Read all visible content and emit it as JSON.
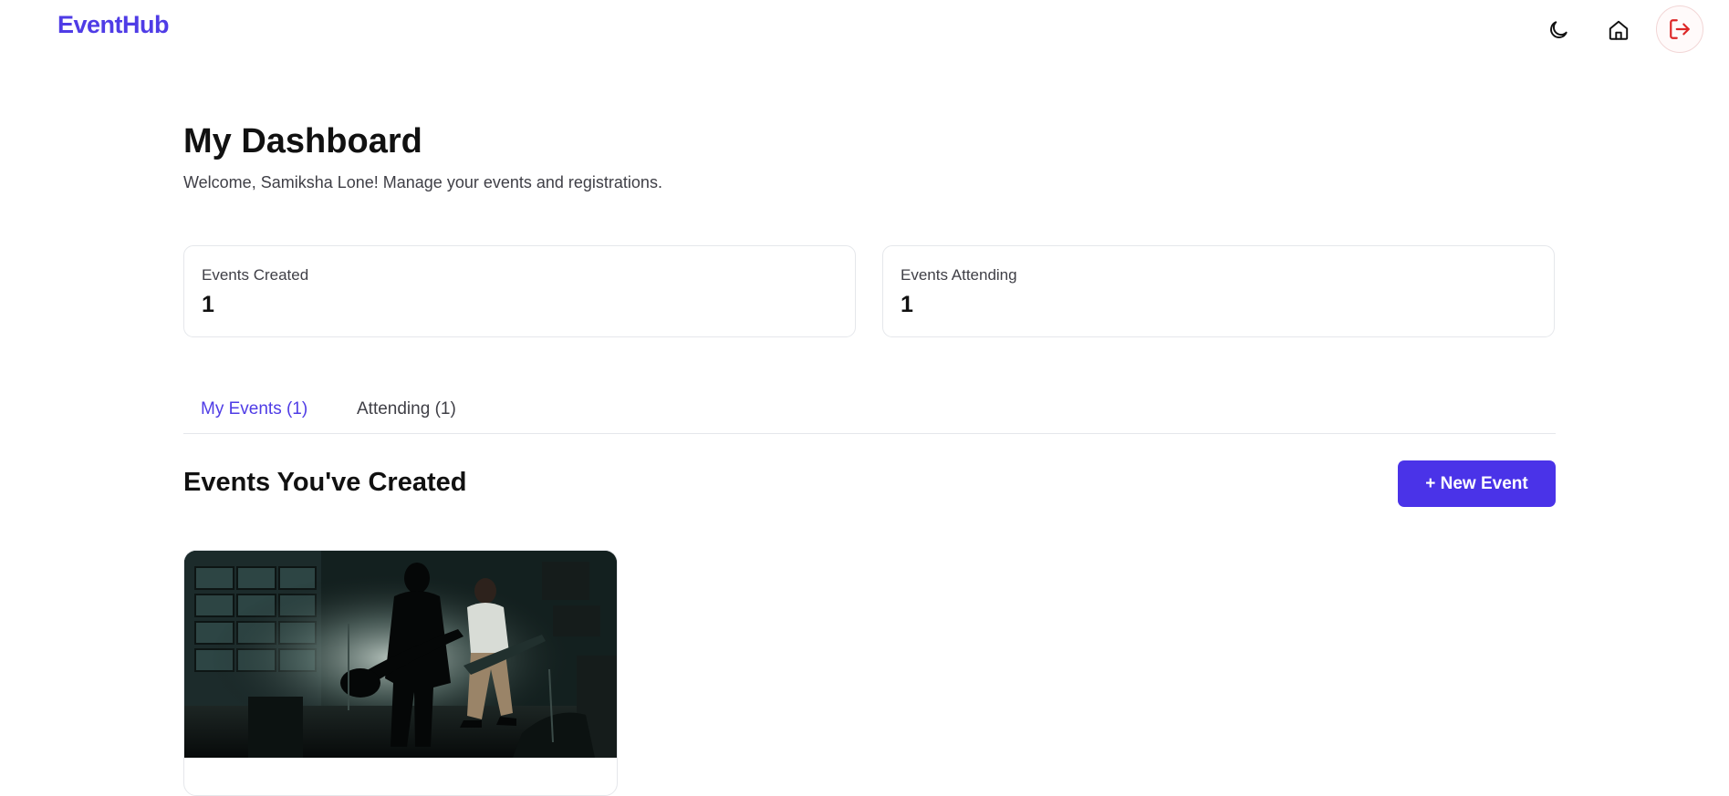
{
  "navbar": {
    "logo": "EventHub",
    "icons": {
      "theme": "moon-icon",
      "home": "home-icon",
      "logout": "logout-icon"
    },
    "colors": {
      "brand": "#4f3ce6",
      "logout": "#dc2626"
    }
  },
  "page": {
    "title": "My Dashboard",
    "subtitle": "Welcome, Samiksha Lone! Manage your events and registrations."
  },
  "stats": [
    {
      "label": "Events Created",
      "value": "1"
    },
    {
      "label": "Events Attending",
      "value": "1"
    }
  ],
  "tabs": [
    {
      "label": "My Events (1)",
      "active": true
    },
    {
      "label": "Attending (1)",
      "active": false
    }
  ],
  "section": {
    "title": "Events You've Created",
    "new_event_label": "+ New Event",
    "button_color": "#4a33e8"
  },
  "events": [
    {
      "image": "concert-photo"
    }
  ]
}
